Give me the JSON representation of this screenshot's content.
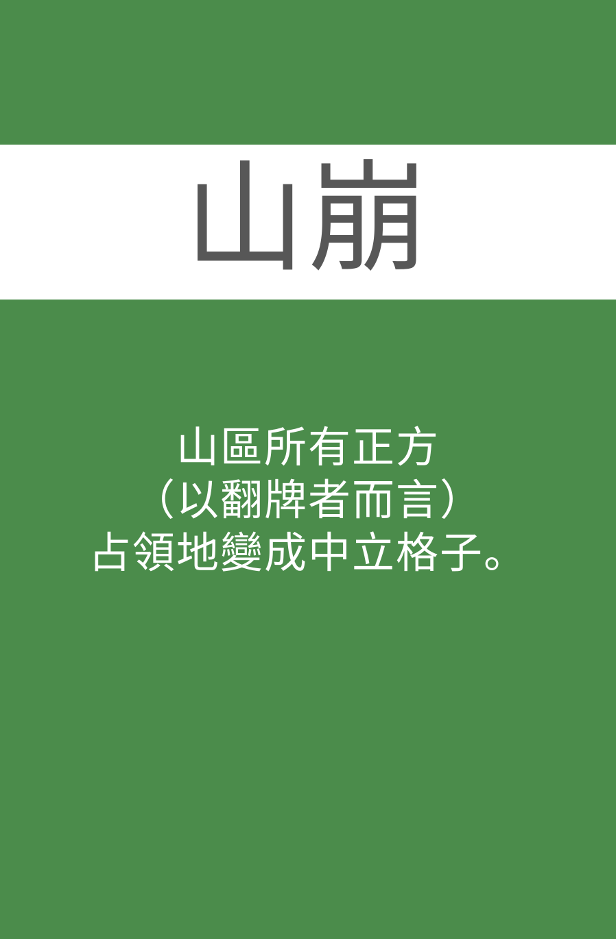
{
  "card": {
    "title": "山崩",
    "description_lines": [
      "山區所有正方",
      "（以翻牌者而言）",
      "占領地變成中立格子。"
    ],
    "colors": {
      "background": "#4b8c4b",
      "title_band": "#ffffff",
      "title_text": "#575757",
      "description_text": "#ffffff"
    }
  }
}
